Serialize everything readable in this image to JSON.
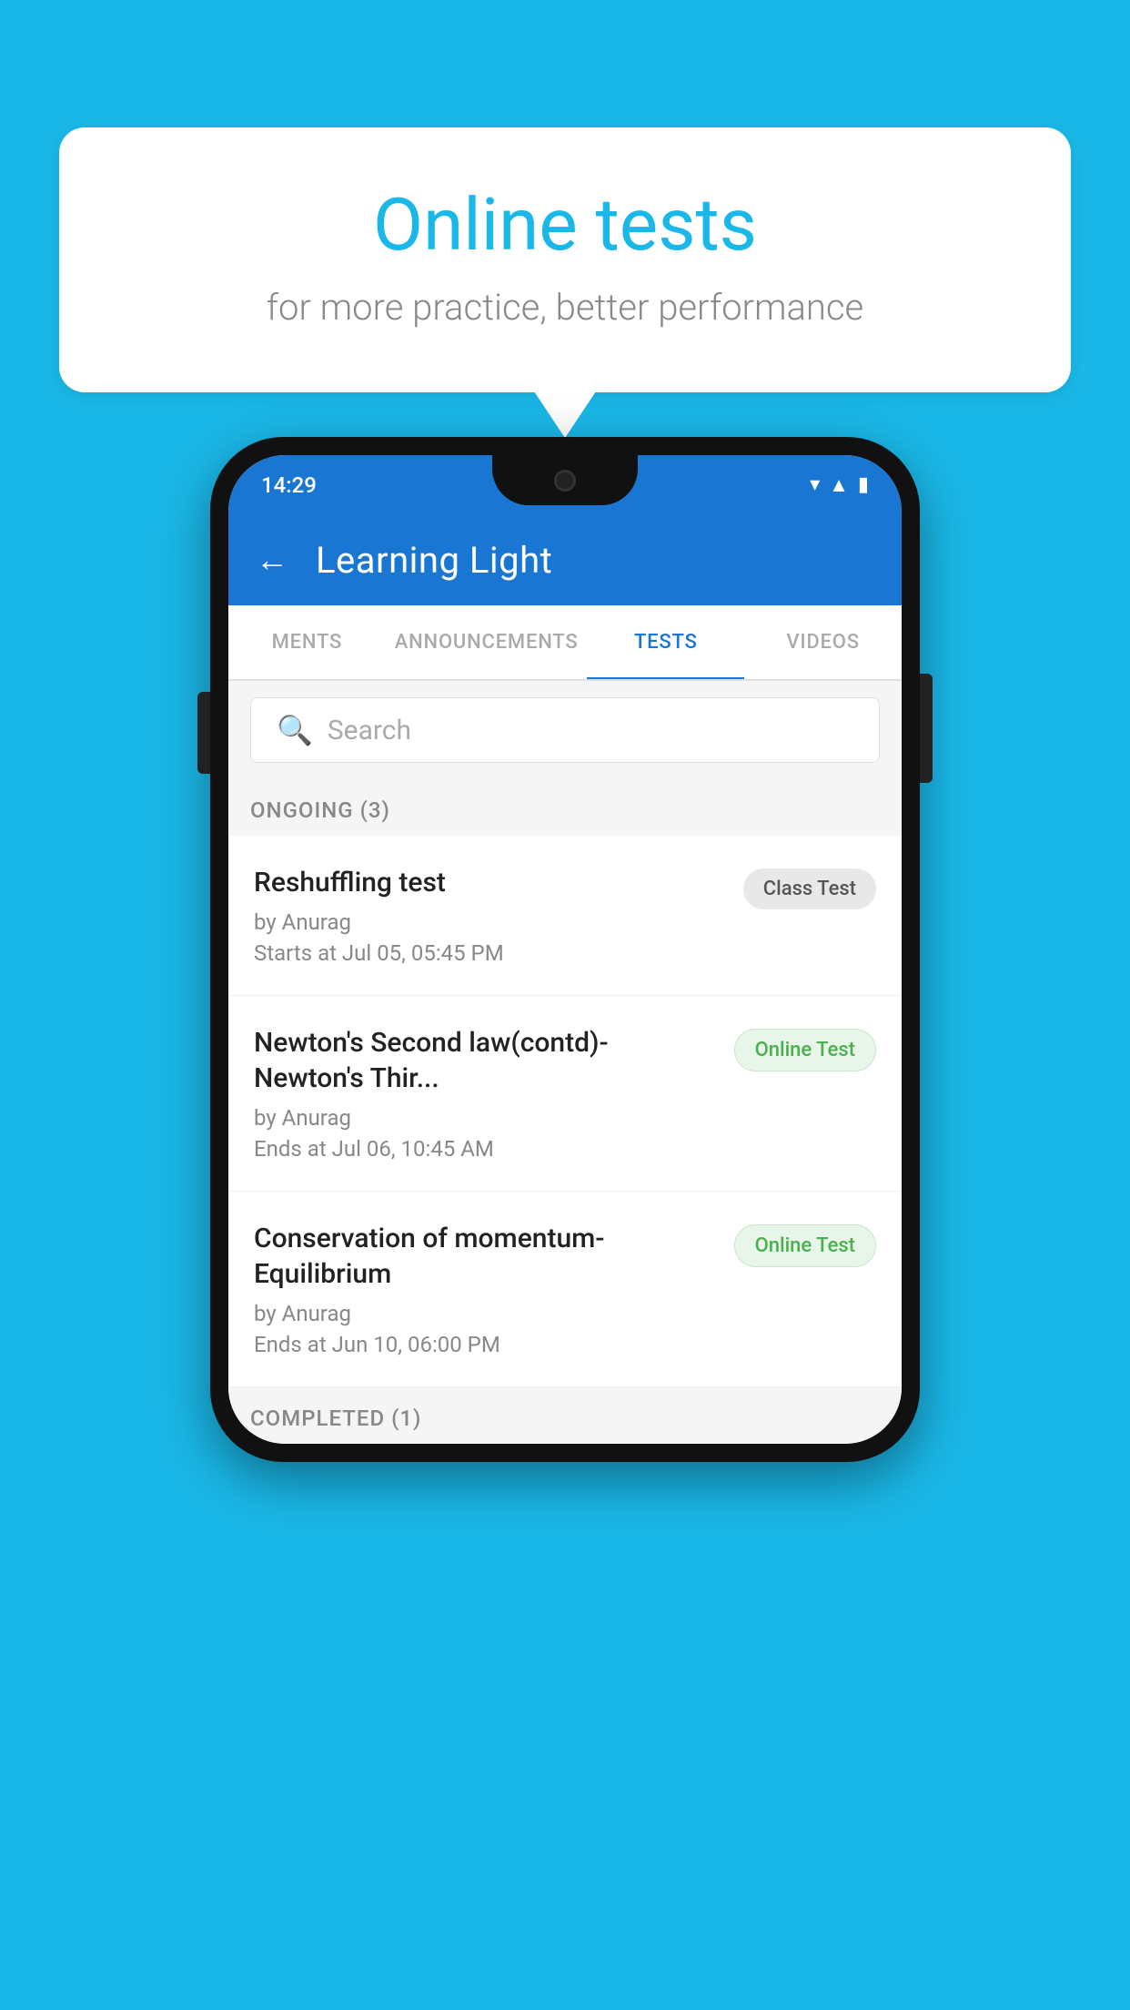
{
  "background_color": "#1ab8e8",
  "speech_bubble": {
    "title": "Online tests",
    "subtitle": "for more practice, better performance"
  },
  "phone": {
    "status_bar": {
      "time": "14:29",
      "icons": [
        "wifi",
        "signal",
        "battery"
      ]
    },
    "app_header": {
      "back_label": "←",
      "title": "Learning Light"
    },
    "tabs": [
      {
        "label": "MENTS",
        "active": false
      },
      {
        "label": "ANNOUNCEMENTS",
        "active": false
      },
      {
        "label": "TESTS",
        "active": true
      },
      {
        "label": "VIDEOS",
        "active": false
      }
    ],
    "search": {
      "placeholder": "Search"
    },
    "sections": [
      {
        "header": "ONGOING (3)",
        "items": [
          {
            "name": "Reshuffling test",
            "author": "by Anurag",
            "time_label": "Starts at  Jul 05, 05:45 PM",
            "badge": "Class Test",
            "badge_type": "class"
          },
          {
            "name": "Newton's Second law(contd)-Newton's Thir...",
            "author": "by Anurag",
            "time_label": "Ends at  Jul 06, 10:45 AM",
            "badge": "Online Test",
            "badge_type": "online"
          },
          {
            "name": "Conservation of momentum-Equilibrium",
            "author": "by Anurag",
            "time_label": "Ends at  Jun 10, 06:00 PM",
            "badge": "Online Test",
            "badge_type": "online"
          }
        ]
      }
    ],
    "completed_header": "COMPLETED (1)"
  }
}
